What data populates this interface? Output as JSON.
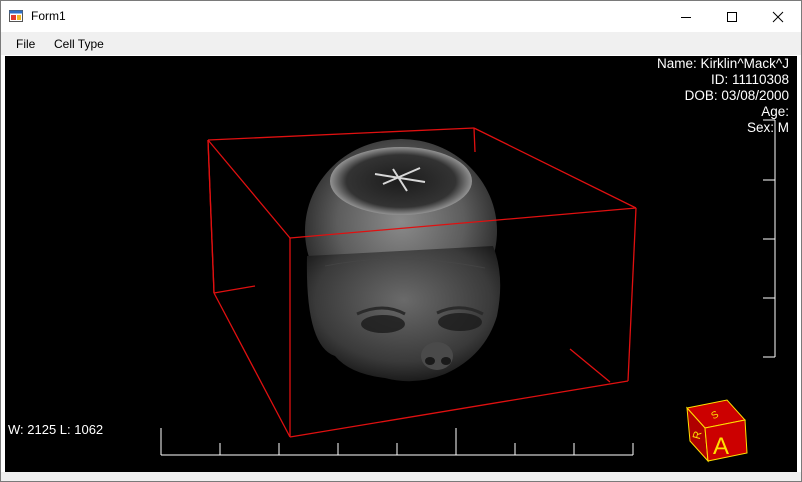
{
  "window": {
    "title": "Form1"
  },
  "menu": {
    "file": "File",
    "cell_type": "Cell Type"
  },
  "overlay": {
    "name": "Name: Kirklin^Mack^J",
    "id": "ID: 11110308",
    "dob": "DOB: 03/08/2000",
    "age": "Age:",
    "sex": "Sex: M",
    "window_level": "W: 2125 L: 1062"
  },
  "orientation_cube": {
    "front": "A",
    "side": "R",
    "top": "S"
  },
  "colors": {
    "bounding_box": "#e01010",
    "cube_face": "#cc0000",
    "cube_letter": "#ffe000"
  }
}
